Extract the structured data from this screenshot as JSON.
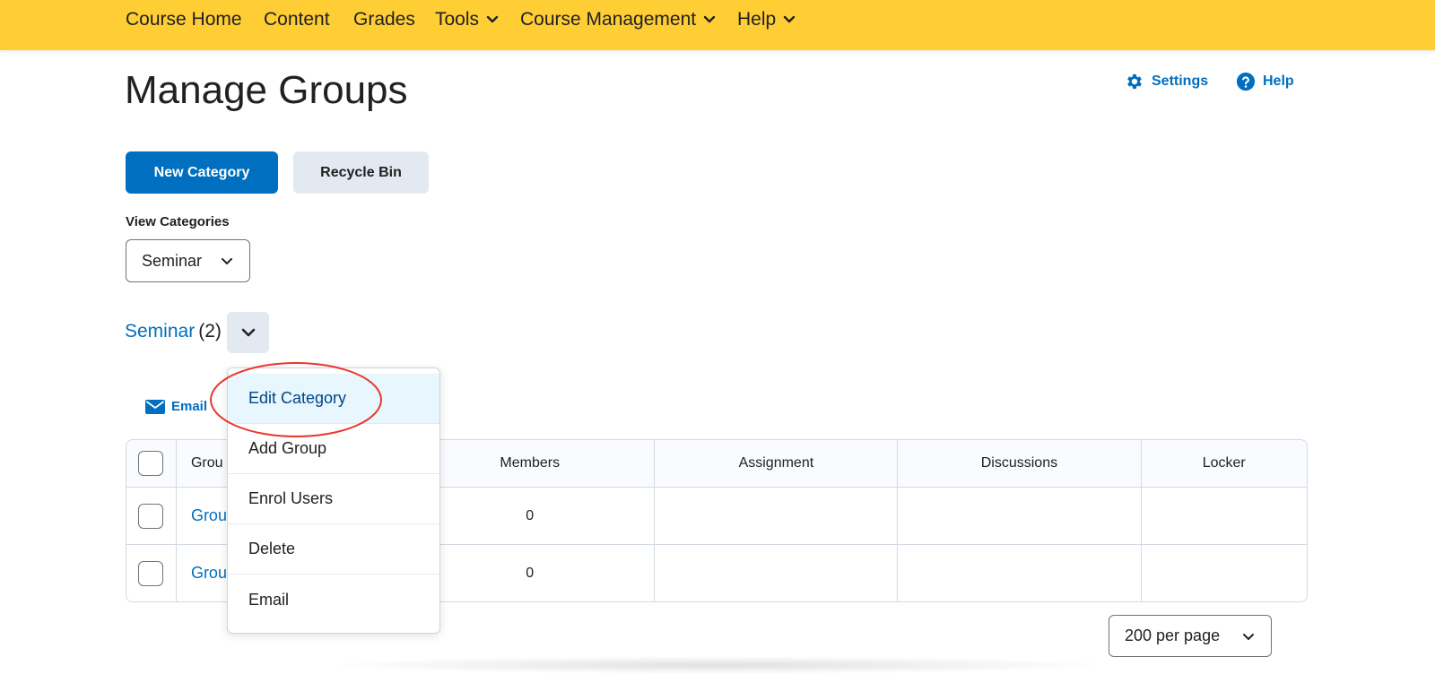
{
  "nav": {
    "items": [
      {
        "label": "Course Home",
        "dropdown": false
      },
      {
        "label": "Content",
        "dropdown": false
      },
      {
        "label": "Grades",
        "dropdown": false
      },
      {
        "label": "Tools",
        "dropdown": true
      },
      {
        "label": "Course Management",
        "dropdown": true
      },
      {
        "label": "Help",
        "dropdown": true
      }
    ]
  },
  "header": {
    "title": "Manage Groups",
    "settings_label": "Settings",
    "help_label": "Help"
  },
  "actions": {
    "new_category": "New Category",
    "recycle_bin": "Recycle Bin"
  },
  "view_categories": {
    "label": "View Categories",
    "selected": "Seminar"
  },
  "category": {
    "name": "Seminar",
    "count": "(2)",
    "email_label": "Email"
  },
  "table": {
    "headers": [
      "Grou",
      "Members",
      "Assignment",
      "Discussions",
      "Locker"
    ],
    "rows": [
      {
        "name": "Grou",
        "members": "0",
        "assignment": "",
        "discussions": "",
        "locker": ""
      },
      {
        "name": "Grou",
        "members": "0",
        "assignment": "",
        "discussions": "",
        "locker": ""
      }
    ]
  },
  "menu": {
    "items": [
      {
        "label": "Edit Category",
        "active": true
      },
      {
        "label": "Add Group",
        "active": false
      },
      {
        "label": "Enrol Users",
        "active": false
      },
      {
        "label": "Delete",
        "active": false
      },
      {
        "label": "Email",
        "active": false
      }
    ]
  },
  "pager": {
    "selected": "200 per page"
  },
  "colors": {
    "nav_bg": "#ffcd34",
    "link": "#006fbf",
    "primary_button": "#006fbf",
    "secondary_button": "#e3e9f1",
    "menu_active_bg": "#e8f6fd",
    "highlight_ring": "#e8382c"
  },
  "icons": {
    "settings": "gear-icon",
    "help": "question-circle-icon",
    "email": "envelope-icon",
    "dropdown": "chevron-down-icon"
  }
}
